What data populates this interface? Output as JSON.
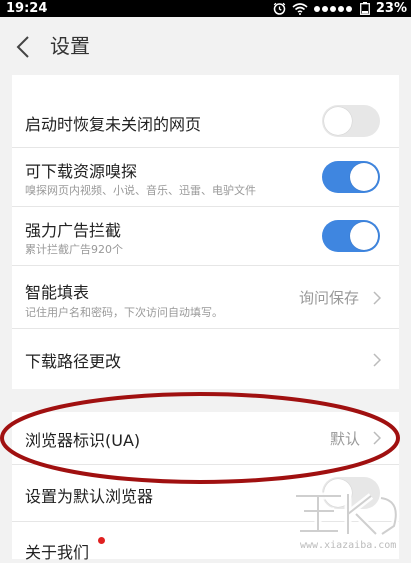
{
  "status_bar": {
    "time": "19:24",
    "battery_percent": "23%",
    "icons": [
      "alarm-icon",
      "wifi-icon",
      "signal-icon",
      "battery-icon"
    ]
  },
  "header": {
    "title": "设置",
    "back_icon": "back-arrow-icon"
  },
  "settings_group_1": [
    {
      "title": "启动时恢复未关闭的网页",
      "control": "toggle",
      "state": "off"
    },
    {
      "title": "可下载资源嗅探",
      "subtitle": "嗅探网页内视频、小说、音乐、迅雷、电驴文件",
      "control": "toggle",
      "state": "on"
    },
    {
      "title": "强力广告拦截",
      "subtitle": "累计拦截广告920个",
      "control": "toggle",
      "state": "on"
    },
    {
      "title": "智能填表",
      "subtitle": "记住用户名和密码，下次访问自动填写。",
      "value": "询问保存",
      "control": "chevron"
    },
    {
      "title": "下载路径更改",
      "control": "chevron"
    }
  ],
  "settings_group_2": [
    {
      "title": "浏览器标识(UA)",
      "value": "默认",
      "control": "chevron",
      "highlighted": true
    },
    {
      "title": "设置为默认浏览器",
      "control": "toggle",
      "state": "off"
    },
    {
      "title": "关于我们",
      "badge": "red-dot"
    }
  ],
  "watermark": {
    "text": "www.xiazaiba.com"
  },
  "colors": {
    "toggle_on": "#3f86e0",
    "toggle_off": "#e7e7e7",
    "highlight_ellipse": "#a01010",
    "badge": "#e02020"
  }
}
